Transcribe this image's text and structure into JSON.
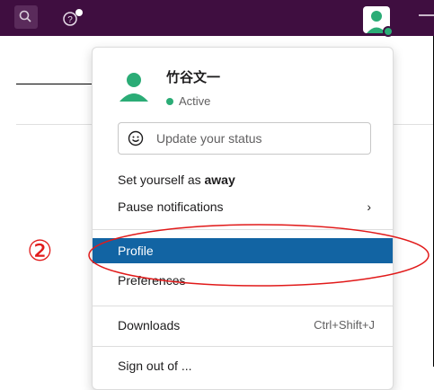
{
  "topbar": {
    "search_icon": "search-icon",
    "help_icon": "help-icon",
    "avatar_icon": "user-avatar-icon",
    "minimize_icon": "minimize-icon"
  },
  "menu": {
    "user_name": "竹谷文一",
    "status_label": "Active",
    "status_color": "#2bac76",
    "status_placeholder": "Update your status",
    "away_prefix": "Set yourself as ",
    "away_bold": "away",
    "pause_label": "Pause notifications",
    "pause_chevron": "›",
    "profile_label": "Profile",
    "preferences_label": "Preferences",
    "downloads_label": "Downloads",
    "downloads_shortcut": "Ctrl+Shift+J",
    "partial_label": "Sign out of ..."
  },
  "annotation": {
    "number": "②",
    "color": "#e11a1a"
  },
  "colors": {
    "topbar": "#3f0e40",
    "highlight": "#1264a3"
  }
}
